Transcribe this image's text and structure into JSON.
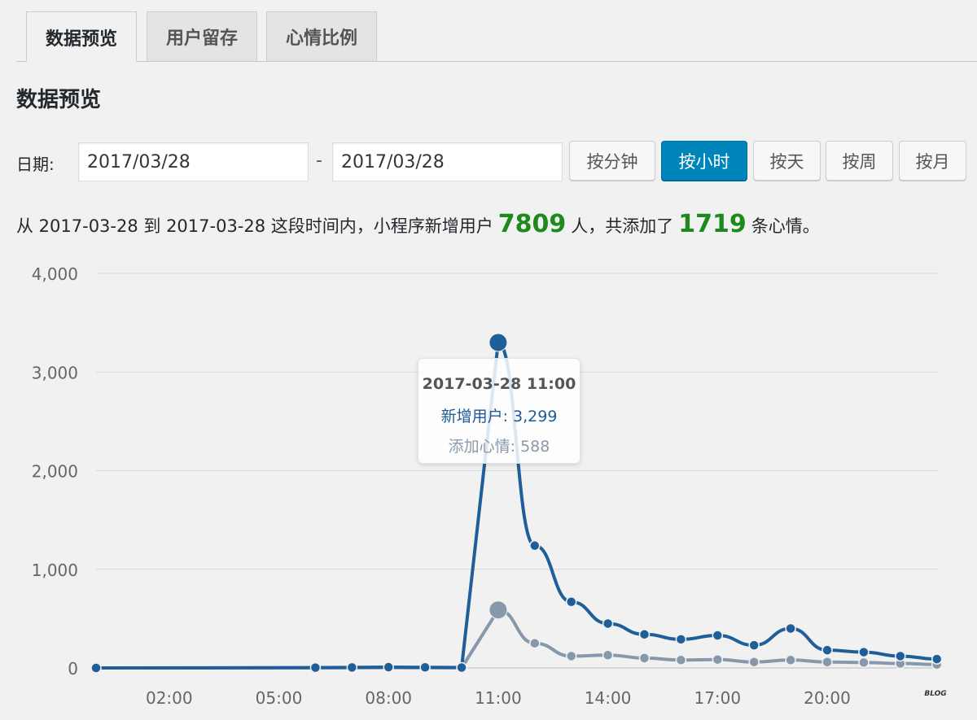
{
  "tabs": [
    {
      "label": "数据预览",
      "active": true
    },
    {
      "label": "用户留存",
      "active": false
    },
    {
      "label": "心情比例",
      "active": false
    }
  ],
  "page_title": "数据预览",
  "date_filter": {
    "label": "日期:",
    "start": "2017/03/28",
    "separator": "-",
    "end": "2017/03/28",
    "buttons": [
      {
        "label": "按分钟",
        "active": false
      },
      {
        "label": "按小时",
        "active": true
      },
      {
        "label": "按天",
        "active": false
      },
      {
        "label": "按周",
        "active": false
      },
      {
        "label": "按月",
        "active": false
      }
    ]
  },
  "summary": {
    "prefix": "从 2017-03-28 到 2017-03-28 这段时间内，小程序新增用户",
    "new_users": "7809",
    "middle": "人，共添加了",
    "moods": "1719",
    "suffix": "条心情。"
  },
  "tooltip": {
    "title": "2017-03-28 11:00",
    "row1": "新增用户: 3,299",
    "row2": "添加心情: 588"
  },
  "colors": {
    "accent": "#0085ba",
    "series_users": "#1f5f99",
    "series_moods": "#8798ab",
    "highlight_number": "#1e8a1e"
  },
  "watermark": "BLOG",
  "chart_data": {
    "type": "line",
    "x": [
      "00:00",
      "01:00",
      "02:00",
      "03:00",
      "04:00",
      "05:00",
      "06:00",
      "07:00",
      "08:00",
      "09:00",
      "10:00",
      "11:00",
      "12:00",
      "13:00",
      "14:00",
      "15:00",
      "16:00",
      "17:00",
      "18:00",
      "19:00",
      "20:00",
      "21:00",
      "22:00",
      "23:00"
    ],
    "x_tick_labels": [
      "02:00",
      "05:00",
      "08:00",
      "11:00",
      "14:00",
      "17:00",
      "20:00"
    ],
    "ylim": [
      0,
      4000
    ],
    "y_ticks": [
      "0",
      "1,000",
      "2,000",
      "3,000",
      "4,000"
    ],
    "grid": true,
    "series": [
      {
        "name": "新增用户",
        "values": [
          0,
          null,
          null,
          null,
          null,
          null,
          3,
          5,
          8,
          6,
          4,
          3299,
          1240,
          670,
          450,
          340,
          290,
          330,
          230,
          400,
          180,
          160,
          120,
          90
        ]
      },
      {
        "name": "添加心情",
        "values": [
          0,
          null,
          null,
          null,
          null,
          null,
          1,
          2,
          3,
          2,
          1,
          588,
          250,
          120,
          130,
          100,
          80,
          85,
          60,
          80,
          60,
          55,
          45,
          35
        ]
      }
    ],
    "highlight_index": 11
  }
}
